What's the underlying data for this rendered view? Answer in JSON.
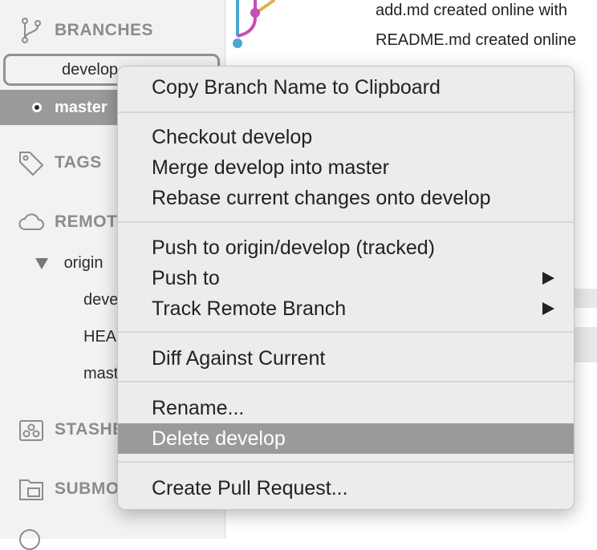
{
  "sidebar": {
    "branches_header": "BRANCHES",
    "branches": [
      {
        "label": "develop",
        "state": "focused"
      },
      {
        "label": "master",
        "state": "current"
      }
    ],
    "tags_header": "TAGS",
    "remotes_header": "REMOTES",
    "remote_name": "origin",
    "remote_branches": [
      "develop",
      "HEAD",
      "master"
    ],
    "stashes_header": "STASHES",
    "submodules_header": "SUBMODULES"
  },
  "commits": [
    {
      "message": "add.md created online with"
    },
    {
      "message": "README.md created online"
    }
  ],
  "context_menu": {
    "items": [
      {
        "label": "Copy Branch Name to Clipboard"
      },
      {
        "label": "Checkout develop"
      },
      {
        "label": "Merge develop into master"
      },
      {
        "label": "Rebase current changes onto develop"
      },
      {
        "label": "Push to origin/develop (tracked)"
      },
      {
        "label": "Push to",
        "submenu": true
      },
      {
        "label": "Track Remote Branch",
        "submenu": true
      },
      {
        "label": "Diff Against Current"
      },
      {
        "label": "Rename..."
      },
      {
        "label": "Delete develop",
        "selected": true
      },
      {
        "label": "Create Pull Request..."
      }
    ]
  },
  "colors": {
    "graph_magenta": "#c44fb5",
    "graph_blue": "#4aa6d6",
    "graph_gold": "#d9b24a",
    "selection": "#9a9a9a"
  }
}
